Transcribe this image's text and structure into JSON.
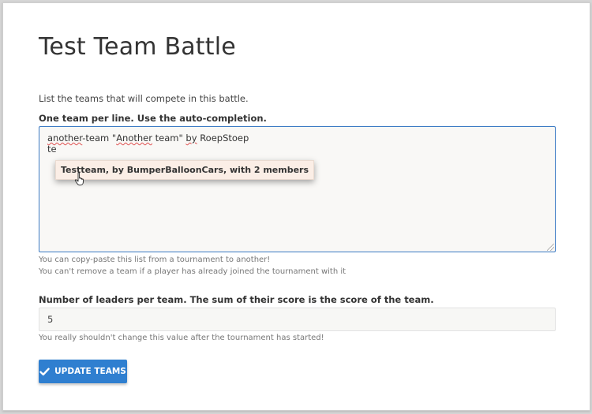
{
  "page": {
    "title": "Test Team Battle",
    "intro": "List the teams that will compete in this battle."
  },
  "teams_field": {
    "label": "One team per line. Use the auto-completion.",
    "line1": {
      "w1": "another",
      "w2": "-team \"",
      "w3": "Another",
      "w4": " team\" ",
      "w5": "by",
      "w6": " ",
      "w7": "RoepStoep"
    },
    "line2": "te",
    "autocomplete_suggestion": "Testteam, by BumperBalloonCars, with 2 members",
    "help_copy": "You can copy-paste this list from a tournament to another!",
    "help_remove": "You can't remove a team if a player has already joined the tournament with it"
  },
  "leaders_field": {
    "label": "Number of leaders per team. The sum of their score is the score of the team.",
    "value": "5",
    "help": "You really shouldn't change this value after the tournament has started!"
  },
  "submit": {
    "label": "UPDATE TEAMS",
    "icon": "check-icon"
  },
  "colors": {
    "accent": "#2f7fd0",
    "focus_border": "#3b7ac4",
    "suggestion_bg": "#fbeee6"
  }
}
